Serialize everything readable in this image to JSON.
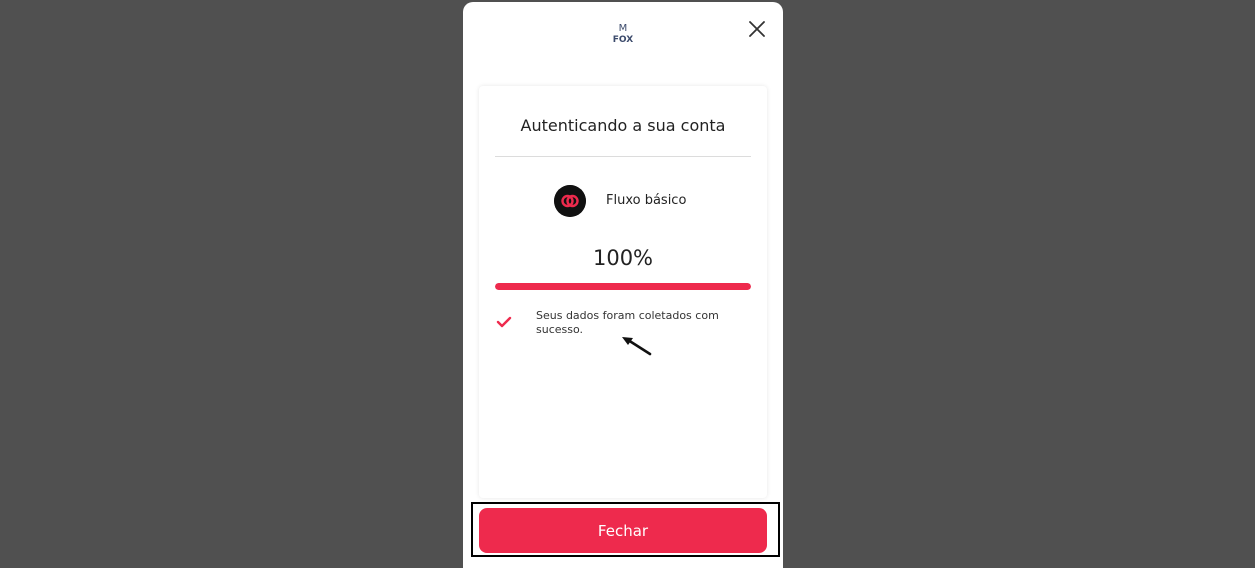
{
  "logo": {
    "text_top": "M",
    "text_bottom": "FOX",
    "color": "#3b4a6b"
  },
  "modal": {
    "close_icon": "close-icon",
    "card": {
      "title": "Autenticando a sua conta",
      "flow": {
        "label": "Fluxo básico",
        "icon": "linked-circles-icon"
      },
      "progress": {
        "text": "100%",
        "value": 100,
        "color": "#ee2a4d"
      },
      "status": {
        "icon": "check-icon",
        "text": "Seus dados foram coletados com sucesso."
      }
    },
    "close_button": {
      "label": "Fechar",
      "color": "#ee2a4d"
    }
  }
}
